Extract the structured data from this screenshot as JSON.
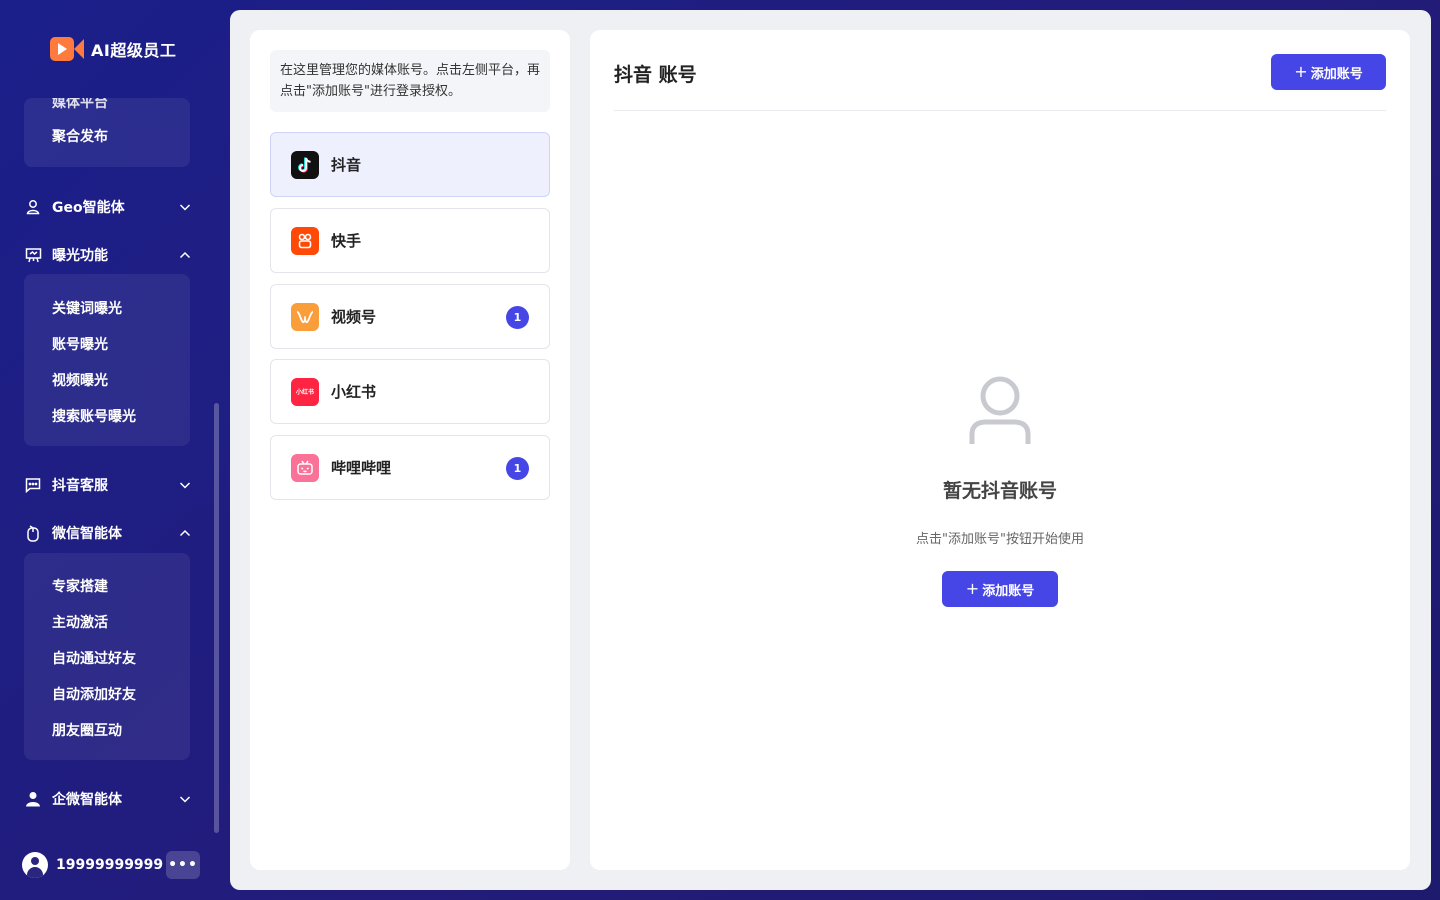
{
  "app": {
    "logo_text": "AI超级员工"
  },
  "sidebar": {
    "clipped_item": "媒体平台",
    "media_items": [
      "聚合发布"
    ],
    "groups": [
      {
        "label": "Geo智能体",
        "icon": "location-person-icon",
        "expanded": false
      },
      {
        "label": "曝光功能",
        "icon": "presentation-board-icon",
        "expanded": true
      },
      {
        "label": "抖音客服",
        "icon": "chat-bubble-icon",
        "expanded": false
      },
      {
        "label": "微信智能体",
        "icon": "mouse-icon",
        "expanded": true
      },
      {
        "label": "企微智能体",
        "icon": "person-icon",
        "expanded": false
      }
    ],
    "exposure_items": [
      "关键词曝光",
      "账号曝光",
      "视频曝光",
      "搜索账号曝光"
    ],
    "wechat_items": [
      "专家搭建",
      "主动激活",
      "自动通过好友",
      "自动添加好友",
      "朋友圈互动"
    ]
  },
  "user": {
    "phone": "19999999999",
    "more_label": "•••"
  },
  "left_panel": {
    "hint": "在这里管理您的媒体账号。点击左侧平台，再点击\"添加账号\"进行登录授权。",
    "platforms": [
      {
        "label": "抖音",
        "icon": "douyin-icon",
        "color": "#111111",
        "badge": null,
        "active": true
      },
      {
        "label": "快手",
        "icon": "kuaishou-icon",
        "color": "#ff4906",
        "badge": null,
        "active": false
      },
      {
        "label": "视频号",
        "icon": "channels-icon",
        "color": "#fa9d3b",
        "badge": "1",
        "active": false
      },
      {
        "label": "小红书",
        "icon": "xiaohongshu-icon",
        "color": "#ff2442",
        "badge": null,
        "active": false,
        "icon_text": "小红书"
      },
      {
        "label": "哔哩哔哩",
        "icon": "bilibili-icon",
        "color": "#fb7299",
        "badge": "1",
        "active": false
      }
    ]
  },
  "right_panel": {
    "title": "抖音 账号",
    "add_button_label": "添加账号",
    "empty_title": "暂无抖音账号",
    "empty_subtitle": "点击\"添加账号\"按钮开始使用",
    "empty_icon": "user-outline-icon"
  },
  "colors": {
    "accent": "#4645e6",
    "sidebar_bg": "#1f1d80"
  }
}
